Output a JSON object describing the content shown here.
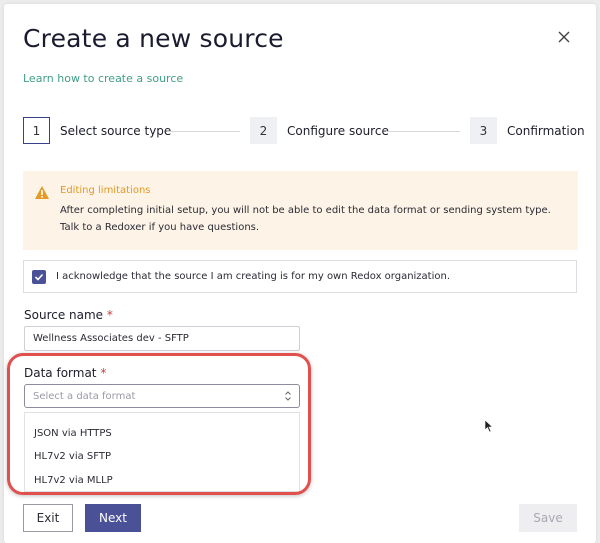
{
  "modal": {
    "title": "Create a new source",
    "learn_link": "Learn how to create a source"
  },
  "stepper": {
    "steps": [
      {
        "number": "1",
        "label": "Select source type",
        "active": true
      },
      {
        "number": "2",
        "label": "Configure source",
        "active": false
      },
      {
        "number": "3",
        "label": "Confirmation",
        "active": false
      }
    ]
  },
  "warning": {
    "icon": "warning-triangle-icon",
    "title": "Editing limitations",
    "text": "After completing initial setup, you will not be able to edit the data format or sending system type. Talk to a Redoxer if you have questions."
  },
  "acknowledge": {
    "checked": true,
    "text": "I acknowledge that the source I am creating is for my own Redox organization."
  },
  "source_name": {
    "label": "Source name",
    "required_mark": "*",
    "value": "Wellness Associates dev - SFTP"
  },
  "data_format": {
    "label": "Data format",
    "required_mark": "*",
    "placeholder": "Select a data format",
    "options": [
      "JSON via HTTPS",
      "HL7v2 via SFTP",
      "HL7v2 via MLLP"
    ]
  },
  "buttons": {
    "exit": "Exit",
    "next": "Next",
    "save": "Save"
  },
  "colors": {
    "accent": "#4b5196",
    "link": "#3f9f87",
    "warning": "#e49a24",
    "highlight": "#e0514e"
  }
}
